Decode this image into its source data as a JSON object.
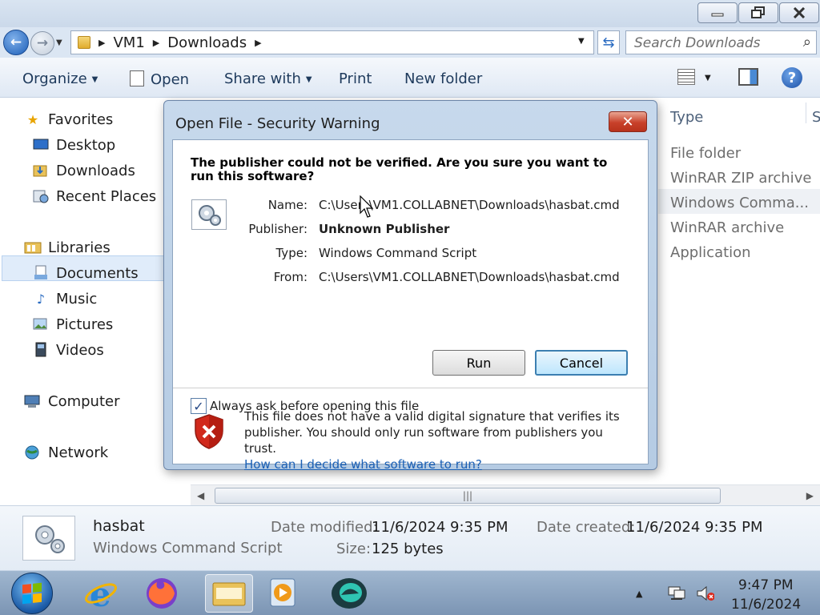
{
  "explorer": {
    "breadcrumb": [
      "VM1",
      "Downloads"
    ],
    "search_placeholder": "Search Downloads",
    "toolbar": {
      "organize": "Organize",
      "open": "Open",
      "share_with": "Share with",
      "print": "Print",
      "new_folder": "New folder"
    },
    "nav": {
      "favorites": "Favorites",
      "desktop": "Desktop",
      "downloads": "Downloads",
      "recent_places": "Recent Places",
      "libraries": "Libraries",
      "documents": "Documents",
      "music": "Music",
      "pictures": "Pictures",
      "videos": "Videos",
      "computer": "Computer",
      "network": "Network"
    },
    "columns": {
      "type": "Type",
      "next": "S"
    },
    "file_types": [
      "File folder",
      "WinRAR ZIP archive",
      "Windows Comma...",
      "WinRAR archive",
      "Application"
    ],
    "details": {
      "name": "hasbat",
      "type": "Windows Command Script",
      "date_modified_label": "Date modified:",
      "date_modified": "11/6/2024 9:35 PM",
      "date_created_label": "Date created:",
      "date_created": "11/6/2024 9:35 PM",
      "size_label": "Size:",
      "size": "125 bytes"
    }
  },
  "dialog": {
    "title": "Open File - Security Warning",
    "heading": "The publisher could not be verified.  Are you sure you want to run this software?",
    "name_label": "Name:",
    "name_value": "C:\\Users\\VM1.COLLABNET\\Downloads\\hasbat.cmd",
    "publisher_label": "Publisher:",
    "publisher_value": "Unknown Publisher",
    "type_label": "Type:",
    "type_value": "Windows Command Script",
    "from_label": "From:",
    "from_value": "C:\\Users\\VM1.COLLABNET\\Downloads\\hasbat.cmd",
    "run_button": "Run",
    "cancel_button": "Cancel",
    "checkbox_label": "Always ask before opening this file",
    "checkbox_checked": true,
    "warning_text": "This file does not have a valid digital signature that verifies its publisher.  You should only run software from publishers you trust.",
    "help_link": "How can I decide what software to run?"
  },
  "taskbar": {
    "time": "9:47 PM",
    "date": "11/6/2024"
  },
  "colors": {
    "accent": "#1a5fb4",
    "close_red": "#c8412a",
    "selection": "#e0ecfa"
  }
}
